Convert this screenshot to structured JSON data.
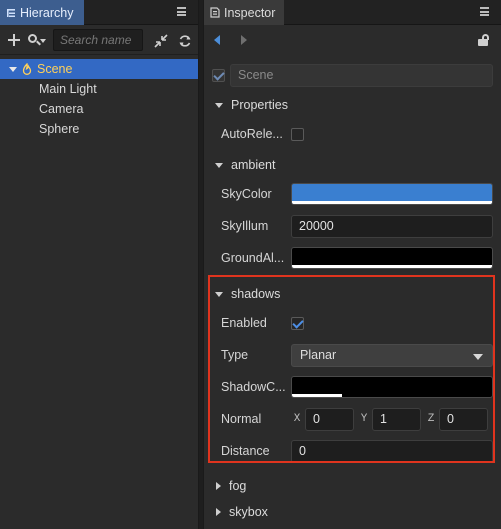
{
  "hierarchy": {
    "tab_label": "Hierarchy",
    "search_placeholder": "Search name",
    "tree": [
      {
        "label": "Scene",
        "selected": true
      },
      {
        "label": "Main Light"
      },
      {
        "label": "Camera"
      },
      {
        "label": "Sphere"
      }
    ]
  },
  "inspector": {
    "tab_label": "Inspector",
    "node_name": "Scene",
    "sections": {
      "properties": {
        "title": "Properties",
        "auto_release_label": "AutoRele...",
        "auto_release_checked": false
      },
      "ambient": {
        "title": "ambient",
        "sky_color_label": "SkyColor",
        "sky_color": "#3a7fd0",
        "sky_illum_label": "SkyIllum",
        "sky_illum_value": "20000",
        "ground_albedo_label": "GroundAl...",
        "ground_albedo_color": "#000000"
      },
      "shadows": {
        "title": "shadows",
        "enabled_label": "Enabled",
        "enabled_checked": true,
        "type_label": "Type",
        "type_value": "Planar",
        "shadow_color_label": "ShadowC...",
        "shadow_color": "#000000",
        "shadow_alpha_fraction": 0.25,
        "normal_label": "Normal",
        "normal": {
          "x_label": "X",
          "x": "0",
          "y_label": "Y",
          "y": "1",
          "z_label": "Z",
          "z": "0"
        },
        "distance_label": "Distance",
        "distance_value": "0"
      },
      "fog": {
        "title": "fog"
      },
      "skybox": {
        "title": "skybox"
      }
    }
  },
  "colors": {
    "accent": "#3369c4",
    "selected_text": "#ffd15a",
    "highlight_border": "#e0341e"
  }
}
